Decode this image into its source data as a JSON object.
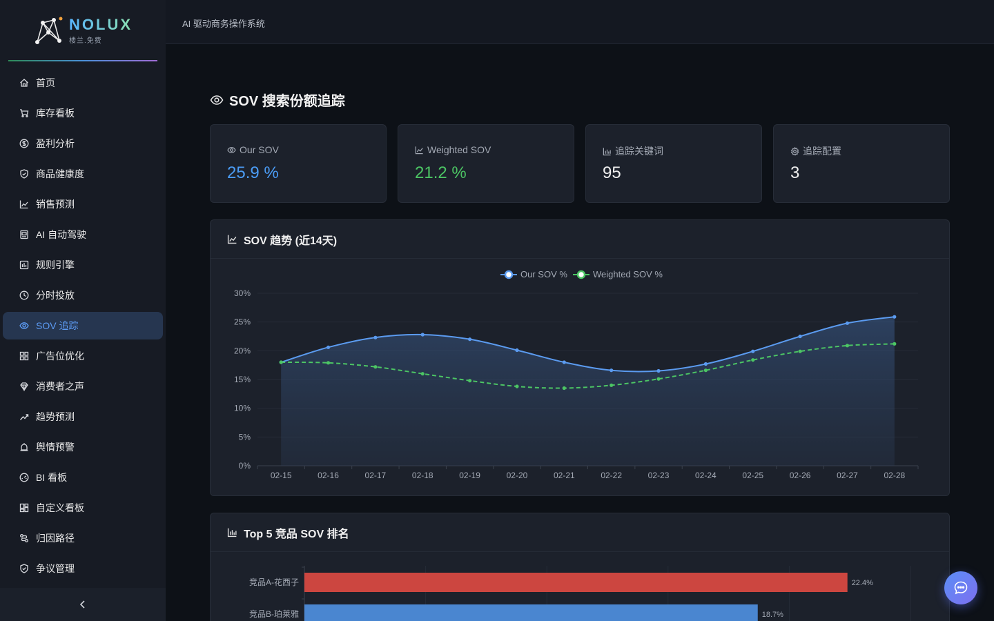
{
  "brand": {
    "name": "NOLUX",
    "subtitle": "楼兰.免费"
  },
  "header": {
    "title": "AI 驱动商务操作系统"
  },
  "sidebar": {
    "items": [
      {
        "label": "首页",
        "icon": "home-icon"
      },
      {
        "label": "库存看板",
        "icon": "cart-icon"
      },
      {
        "label": "盈利分析",
        "icon": "dollar-icon"
      },
      {
        "label": "商品健康度",
        "icon": "shield-check-icon"
      },
      {
        "label": "销售预测",
        "icon": "line-chart-icon"
      },
      {
        "label": "AI 自动驾驶",
        "icon": "robot-icon"
      },
      {
        "label": "规则引擎",
        "icon": "rules-icon"
      },
      {
        "label": "分时投放",
        "icon": "clock-icon"
      },
      {
        "label": "SOV 追踪",
        "icon": "eye-icon",
        "active": true
      },
      {
        "label": "广告位优化",
        "icon": "grid-icon"
      },
      {
        "label": "消费者之声",
        "icon": "crown-icon"
      },
      {
        "label": "趋势预测",
        "icon": "trend-up-icon"
      },
      {
        "label": "舆情预警",
        "icon": "alarm-icon"
      },
      {
        "label": "BI 看板",
        "icon": "dashboard-icon"
      },
      {
        "label": "自定义看板",
        "icon": "layout-icon"
      },
      {
        "label": "归因路径",
        "icon": "path-icon"
      },
      {
        "label": "争议管理",
        "icon": "shield-icon"
      }
    ]
  },
  "page": {
    "title": "SOV 搜索份额追踪"
  },
  "stats": [
    {
      "label": "Our SOV",
      "value": "25.9",
      "unit": "%",
      "icon": "eye-icon",
      "color": "#4b9cf5"
    },
    {
      "label": "Weighted SOV",
      "value": "21.2",
      "unit": "%",
      "icon": "line-chart-icon",
      "color": "#4cc564"
    },
    {
      "label": "追踪关键词",
      "value": "95",
      "unit": "",
      "icon": "bar-chart-icon",
      "color": "#f0f0f0"
    },
    {
      "label": "追踪配置",
      "value": "3",
      "unit": "",
      "icon": "gear-icon",
      "color": "#f0f0f0"
    }
  ],
  "trend_panel": {
    "title": "SOV 趋势 (近14天)"
  },
  "top5_panel": {
    "title": "Top 5 竞品 SOV 排名"
  },
  "chart_data": [
    {
      "type": "line",
      "title": "SOV 趋势 (近14天)",
      "categories": [
        "02-15",
        "02-16",
        "02-17",
        "02-18",
        "02-19",
        "02-20",
        "02-21",
        "02-22",
        "02-23",
        "02-24",
        "02-25",
        "02-26",
        "02-27",
        "02-28"
      ],
      "series": [
        {
          "name": "Our SOV %",
          "color": "#5b9bf0",
          "values": [
            18.0,
            20.6,
            22.3,
            22.8,
            22.0,
            20.1,
            18.0,
            16.6,
            16.5,
            17.7,
            19.9,
            22.5,
            24.8,
            25.9
          ]
        },
        {
          "name": "Weighted SOV %",
          "color": "#4cc564",
          "values": [
            18.0,
            17.9,
            17.2,
            16.0,
            14.8,
            13.8,
            13.5,
            14.0,
            15.1,
            16.6,
            18.4,
            19.9,
            20.9,
            21.2
          ]
        }
      ],
      "ylim": [
        0,
        30
      ],
      "yticks": [
        "0%",
        "5%",
        "10%",
        "15%",
        "20%",
        "25%",
        "30%"
      ],
      "legend": "top-center",
      "grid": true
    },
    {
      "type": "bar",
      "orientation": "horizontal",
      "title": "Top 5 竞品 SOV 排名",
      "categories": [
        "竞品A-花西子",
        "竞品B-珀莱雅"
      ],
      "values": [
        22.4,
        18.7
      ],
      "labels": [
        "22.4%",
        "18.7%"
      ],
      "colors": [
        "#cc4640",
        "#4a86d0"
      ],
      "xlim": [
        0,
        25
      ]
    }
  ],
  "chat": {
    "icon": "chat-icon"
  }
}
